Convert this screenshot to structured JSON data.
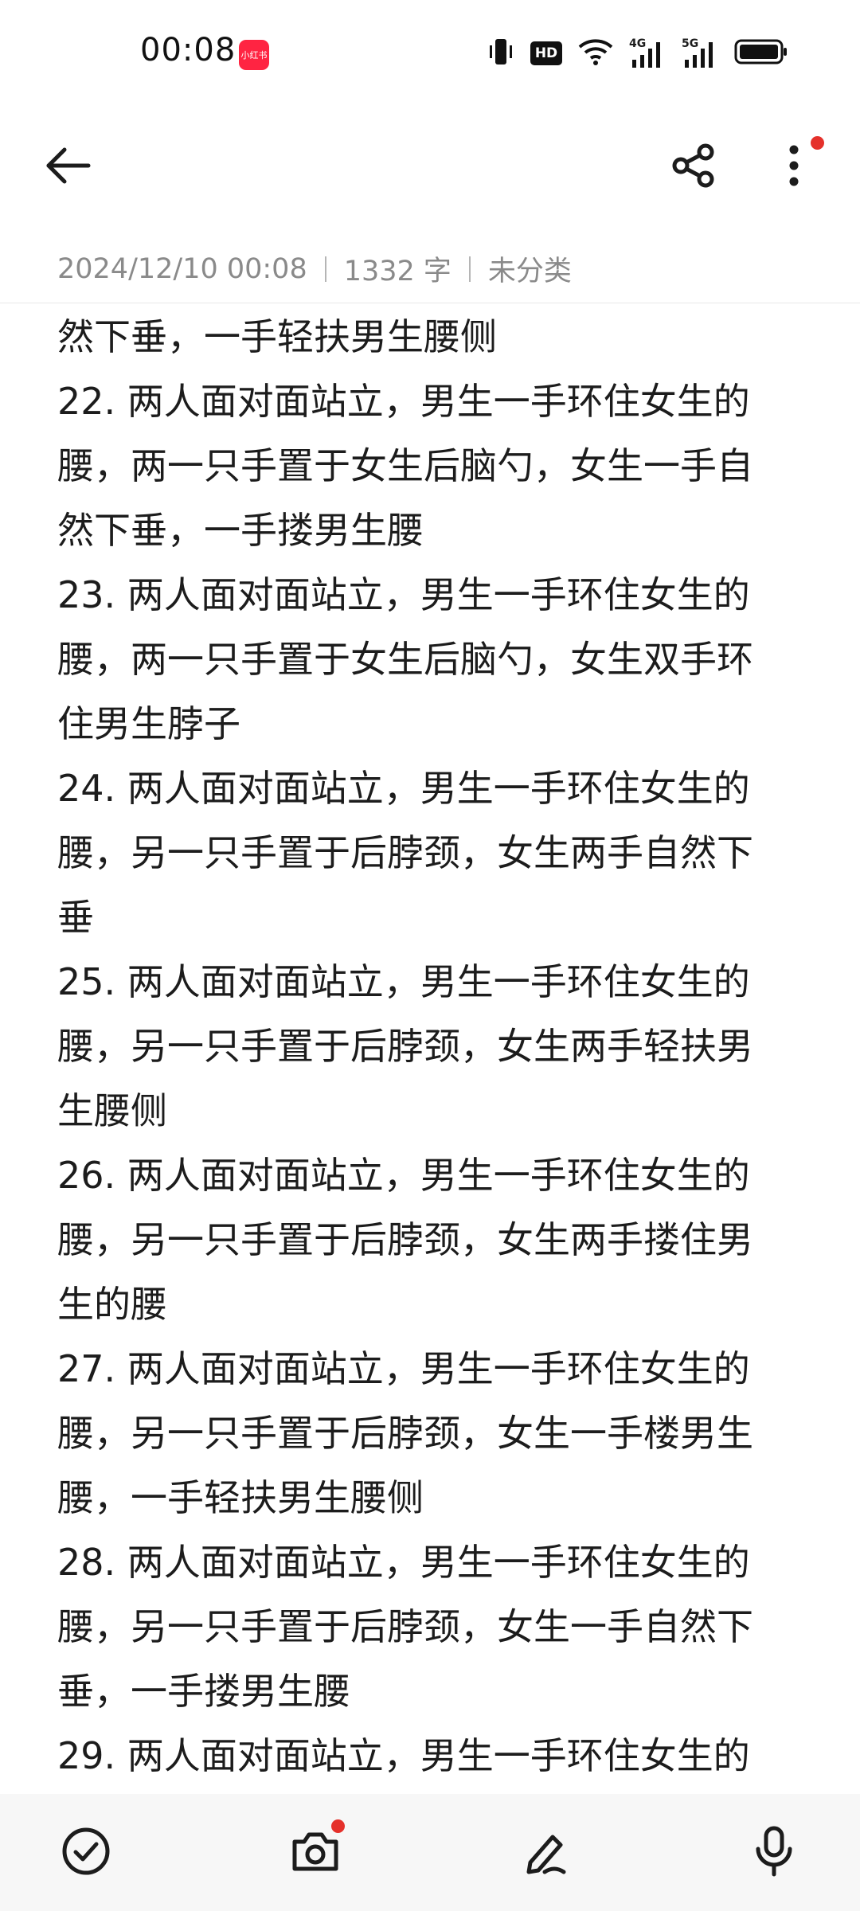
{
  "status_bar": {
    "time": "00:08",
    "app_badge": "小红书",
    "hd_label": "HD",
    "net_4g": "4G",
    "net_5g": "5G",
    "icons": [
      "vibrate-icon",
      "hd-voice-icon",
      "wifi-icon",
      "signal-4g-icon",
      "signal-5g-icon",
      "battery-icon"
    ]
  },
  "toolbar": {
    "icons": [
      "back-arrow-icon",
      "share-icon",
      "more-vertical-icon"
    ],
    "accent_dot_color": "#e5312b"
  },
  "meta": {
    "datetime": "2024/12/10 00:08",
    "word_count": "1332 字",
    "category": "未分类"
  },
  "note": {
    "lines": [
      "然下垂，一手轻扶男生腰侧",
      "22. 两人面对面站立，男生一手环住女生的",
      "腰，两一只手置于女生后脑勺，女生一手自",
      "然下垂，一手搂男生腰",
      "23. 两人面对面站立，男生一手环住女生的",
      "腰，两一只手置于女生后脑勺，女生双手环",
      "住男生脖子",
      "24. 两人面对面站立，男生一手环住女生的",
      "腰，另一只手置于后脖颈，女生两手自然下",
      "垂",
      "25. 两人面对面站立，男生一手环住女生的",
      "腰，另一只手置于后脖颈，女生两手轻扶男",
      "生腰侧",
      "26. 两人面对面站立，男生一手环住女生的",
      "腰，另一只手置于后脖颈，女生两手搂住男",
      "生的腰",
      "27. 两人面对面站立，男生一手环住女生的",
      "腰，另一只手置于后脖颈，女生一手楼男生",
      "腰，一手轻扶男生腰侧",
      "28. 两人面对面站立，男生一手环住女生的",
      "腰，另一只手置于后脖颈，女生一手自然下",
      "垂，一手搂男生腰",
      "29. 两人面对面站立，男生一手环住女生的"
    ]
  },
  "bottom_bar": {
    "icons": [
      "checklist-icon",
      "camera-icon",
      "handwriting-pen-icon",
      "microphone-icon"
    ]
  }
}
